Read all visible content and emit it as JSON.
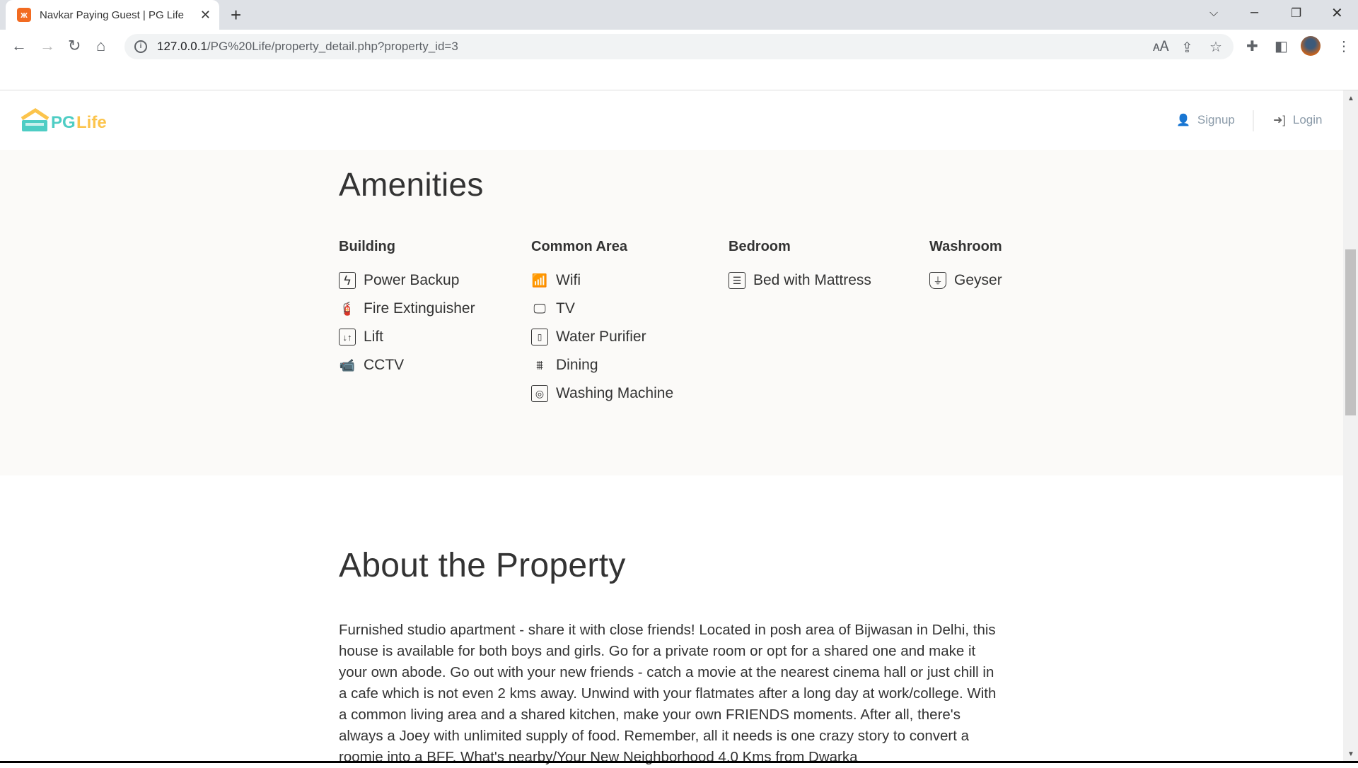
{
  "browser": {
    "tab_title": "Navkar Paying Guest | PG Life",
    "url": "127.0.0.1/PG%20Life/property_detail.php?property_id=3",
    "url_host": "127.0.0.1",
    "url_path": "/PG%20Life/property_detail.php?property_id=3"
  },
  "header": {
    "logo_text_pg": "PG",
    "logo_text_life": "Life",
    "signup_label": "Signup",
    "login_label": "Login",
    "colors": {
      "logo_teal": "#4ecdc4",
      "logo_yellow": "#fcc44c"
    }
  },
  "amenities": {
    "title": "Amenities",
    "columns": [
      {
        "heading": "Building",
        "items": [
          {
            "label": "Power Backup",
            "icon": "power-backup-icon"
          },
          {
            "label": "Fire Extinguisher",
            "icon": "fire-extinguisher-icon"
          },
          {
            "label": "Lift",
            "icon": "lift-icon"
          },
          {
            "label": "CCTV",
            "icon": "cctv-icon"
          }
        ]
      },
      {
        "heading": "Common Area",
        "items": [
          {
            "label": "Wifi",
            "icon": "wifi-icon"
          },
          {
            "label": "TV",
            "icon": "tv-icon"
          },
          {
            "label": "Water Purifier",
            "icon": "water-purifier-icon"
          },
          {
            "label": "Dining",
            "icon": "dining-icon"
          },
          {
            "label": "Washing Machine",
            "icon": "washing-machine-icon"
          }
        ]
      },
      {
        "heading": "Bedroom",
        "items": [
          {
            "label": "Bed with Mattress",
            "icon": "bed-icon"
          }
        ]
      },
      {
        "heading": "Washroom",
        "items": [
          {
            "label": "Geyser",
            "icon": "geyser-icon"
          }
        ]
      }
    ]
  },
  "about": {
    "title": "About the Property",
    "description": "Furnished studio apartment - share it with close friends! Located in posh area of Bijwasan in Delhi, this house is available for both boys and girls. Go for a private room or opt for a shared one and make it your own abode. Go out with your new friends - catch a movie at the nearest cinema hall or just chill in a cafe which is not even 2 kms away. Unwind with your flatmates after a long day at work/college. With a common living area and a shared kitchen, make your own FRIENDS moments. After all, there's always a Joey with unlimited supply of food. Remember, all it needs is one crazy story to convert a roomie into a BFF. What's nearby/Your New Neighborhood 4.0 Kms from Dwarka"
  }
}
